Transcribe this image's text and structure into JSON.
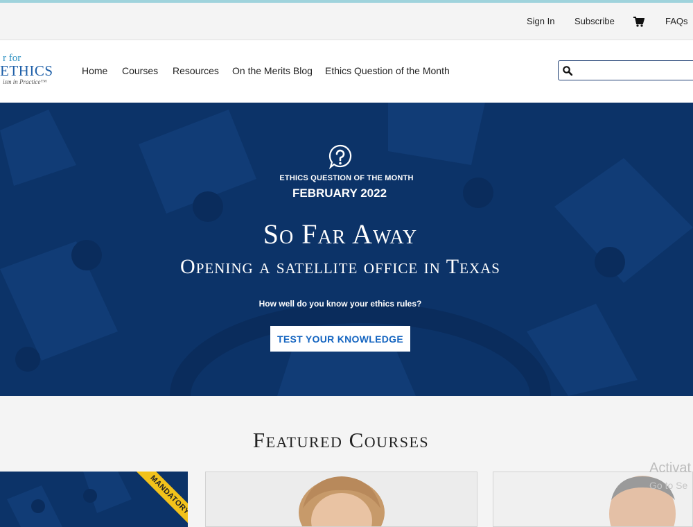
{
  "utility_nav": {
    "sign_in": "Sign In",
    "subscribe": "Subscribe",
    "cart_icon": "shopping-cart-icon",
    "faqs": "FAQs"
  },
  "logo": {
    "line1": "r for",
    "line2": "ETHICS",
    "line3": "ism in Practice™"
  },
  "main_nav": {
    "items": [
      {
        "label": "Home"
      },
      {
        "label": "Courses"
      },
      {
        "label": "Resources"
      },
      {
        "label": "On the Merits Blog"
      },
      {
        "label": "Ethics Question of the Month"
      }
    ]
  },
  "search": {
    "icon": "search-icon",
    "value": ""
  },
  "hero": {
    "icon": "question-bubble-icon",
    "eyebrow": "ETHICS QUESTION OF THE MONTH",
    "date": "FEBRUARY 2022",
    "title": "So Far Away",
    "subtitle": "Opening a satellite office in Texas",
    "prompt": "How well do you know your ethics rules?",
    "cta_label": "TEST YOUR KNOWLEDGE",
    "background_color": "#0c3368"
  },
  "featured": {
    "title": "Featured Courses",
    "cards": [
      {
        "ribbon": "MANDATORY"
      },
      {
        "image": "instructor-portrait"
      },
      {
        "image": "instructor-portrait"
      }
    ]
  },
  "os_overlay": {
    "line1": "Activat",
    "line2": "Go to Se"
  },
  "colors": {
    "brand_navy": "#0c3368",
    "link_blue": "#1565c0",
    "ribbon_yellow": "#f2c21b"
  }
}
